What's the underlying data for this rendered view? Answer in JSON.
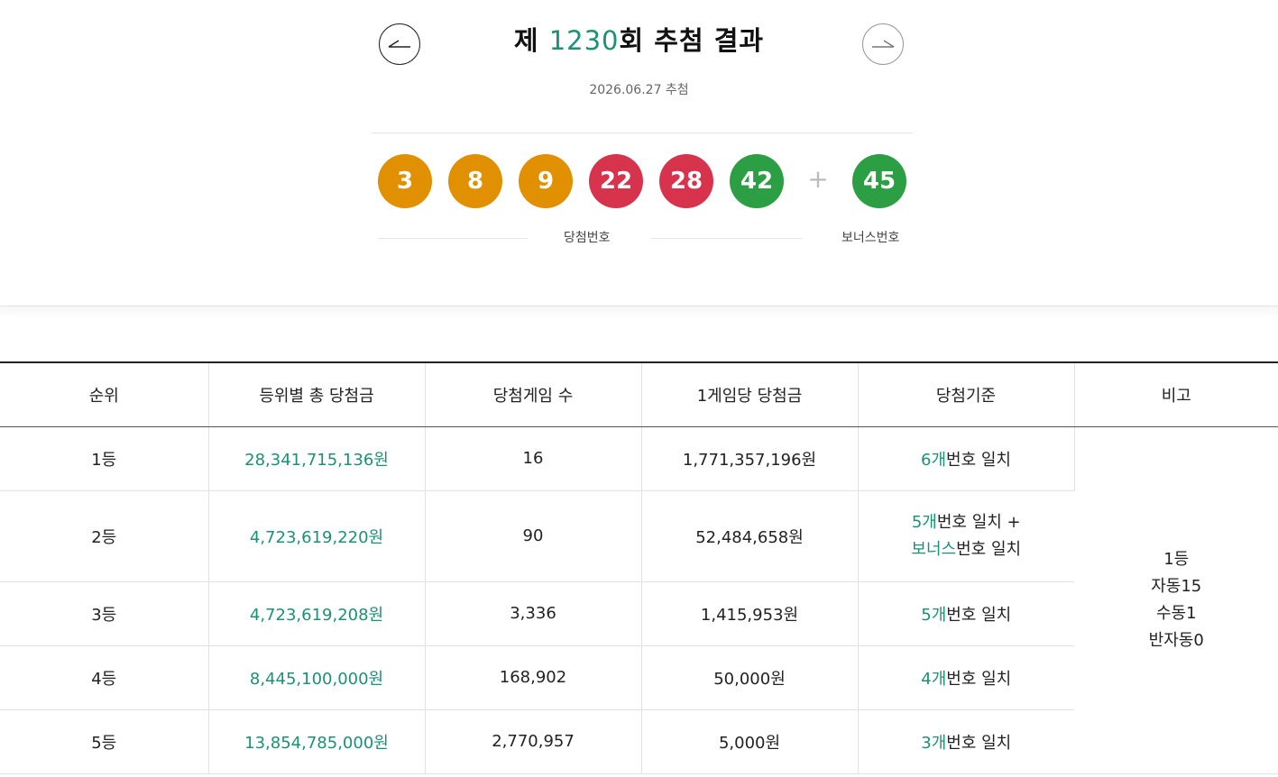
{
  "header": {
    "title_prefix": "제 ",
    "draw_number": "1230",
    "title_suffix": "회 추첨 결과",
    "date": "2026.06.27 추첨"
  },
  "nav": {
    "prev_icon": "arrow-left-icon",
    "next_icon": "arrow-right-icon"
  },
  "balls": [
    {
      "value": "3",
      "color": "#e09000"
    },
    {
      "value": "8",
      "color": "#e09000"
    },
    {
      "value": "9",
      "color": "#e09000"
    },
    {
      "value": "22",
      "color": "#d8334d"
    },
    {
      "value": "28",
      "color": "#d8334d"
    },
    {
      "value": "42",
      "color": "#2c9e44"
    }
  ],
  "plus_sign": "+",
  "bonus_ball": {
    "value": "45",
    "color": "#2c9e44"
  },
  "captions": {
    "winning": "당첨번호",
    "bonus": "보너스번호"
  },
  "table": {
    "headers": [
      "순위",
      "등위별 총 당첨금",
      "당첨게임 수",
      "1게임당 당첨금",
      "당첨기준",
      "비고"
    ],
    "rows": [
      {
        "rank": "1등",
        "total": "28,341,715,136원",
        "games": "16",
        "per_game": "1,771,357,196원",
        "criteria_hl": "6개",
        "criteria_rest": "번호 일치"
      },
      {
        "rank": "2등",
        "total": "4,723,619,220원",
        "games": "90",
        "per_game": "52,484,658원",
        "criteria_hl": "5개",
        "criteria_rest": "번호 일치 +",
        "criteria_hl2": "보너스",
        "criteria_rest2": "번호 일치"
      },
      {
        "rank": "3등",
        "total": "4,723,619,208원",
        "games": "3,336",
        "per_game": "1,415,953원",
        "criteria_hl": "5개",
        "criteria_rest": "번호 일치"
      },
      {
        "rank": "4등",
        "total": "8,445,100,000원",
        "games": "168,902",
        "per_game": "50,000원",
        "criteria_hl": "4개",
        "criteria_rest": "번호 일치"
      },
      {
        "rank": "5등",
        "total": "13,854,785,000원",
        "games": "2,770,957",
        "per_game": "5,000원",
        "criteria_hl": "3개",
        "criteria_rest": "번호 일치"
      }
    ],
    "note_lines": [
      "1등",
      "자동15",
      "수동1",
      "반자동0"
    ]
  }
}
